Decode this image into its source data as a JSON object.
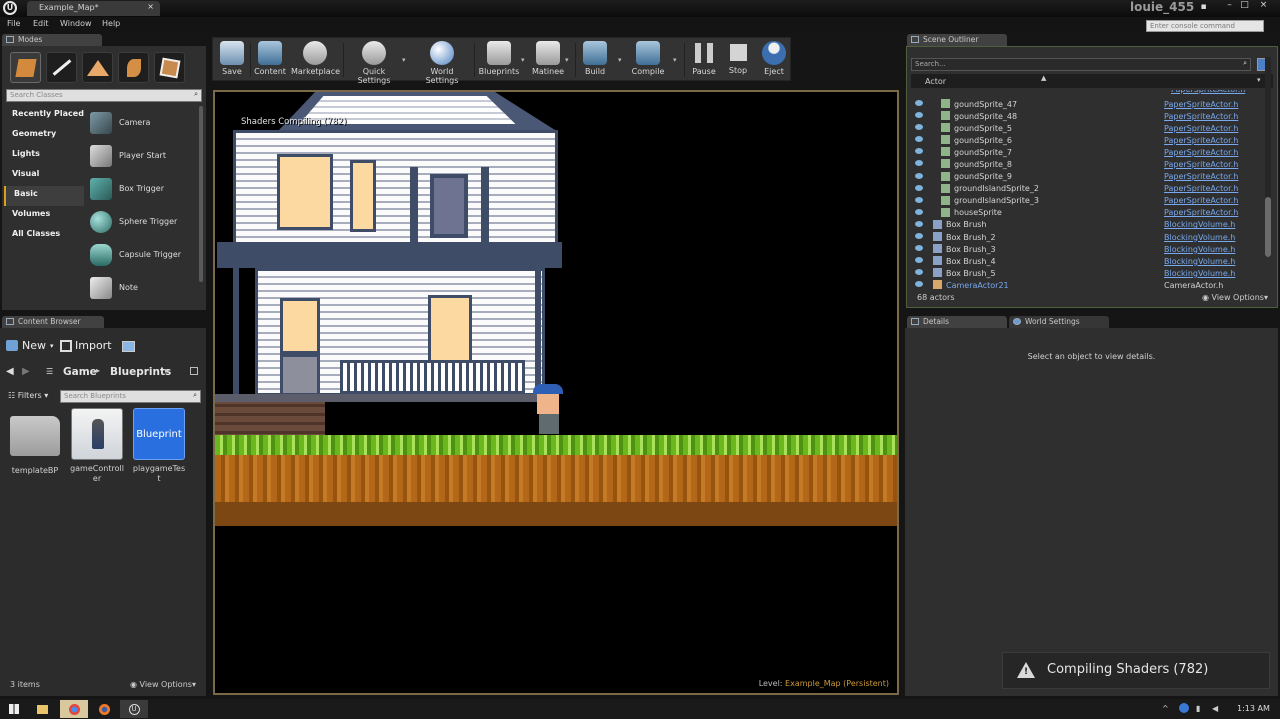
{
  "window": {
    "doc_tab": "Example_Map*",
    "username": "louie_455",
    "console_placeholder": "Enter console command"
  },
  "menu": [
    "File",
    "Edit",
    "Window",
    "Help"
  ],
  "modes": {
    "tab": "Modes",
    "search_placeholder": "Search Classes",
    "categories": [
      "Recently Placed",
      "Geometry",
      "Lights",
      "Visual",
      "Basic",
      "Volumes",
      "All Classes"
    ],
    "selected_category": "Basic",
    "items": [
      "Camera",
      "Player Start",
      "Box Trigger",
      "Sphere Trigger",
      "Capsule Trigger",
      "Note"
    ]
  },
  "toolbar": {
    "buttons": [
      "Save",
      "Content",
      "Marketplace",
      "Quick Settings",
      "World Settings",
      "Blueprints",
      "Matinee",
      "Build",
      "Compile",
      "Pause",
      "Stop",
      "Eject"
    ]
  },
  "viewport": {
    "overlay": "Shaders Compiling (782)",
    "level_label": "Level:",
    "level_name": "Example_Map (Persistent)"
  },
  "content_browser": {
    "tab": "Content Browser",
    "new_label": "New",
    "import_label": "Import",
    "path": [
      "Game",
      "Blueprints"
    ],
    "filters_label": "Filters",
    "search_placeholder": "Search Blueprints",
    "assets": [
      {
        "name": "templateBP",
        "kind": "folder"
      },
      {
        "name": "gameController",
        "kind": "blueprint"
      },
      {
        "name": "playgameTest",
        "kind": "blueprint"
      }
    ],
    "blueprint_thumb_label": "Blueprint",
    "item_count": "3 items",
    "view_options": "View Options"
  },
  "outliner": {
    "tab": "Scene Outliner",
    "search_placeholder": "Search...",
    "column": "Actor",
    "rows": [
      {
        "name": "goundSprite_47",
        "type": "PaperSpriteActor.h",
        "indent": 2,
        "selected": false
      },
      {
        "name": "goundSprite_48",
        "type": "PaperSpriteActor.h",
        "indent": 2,
        "selected": false
      },
      {
        "name": "goundSprite_5",
        "type": "PaperSpriteActor.h",
        "indent": 2,
        "selected": false
      },
      {
        "name": "goundSprite_6",
        "type": "PaperSpriteActor.h",
        "indent": 2,
        "selected": false
      },
      {
        "name": "goundSprite_7",
        "type": "PaperSpriteActor.h",
        "indent": 2,
        "selected": false
      },
      {
        "name": "goundSprite_8",
        "type": "PaperSpriteActor.h",
        "indent": 2,
        "selected": false
      },
      {
        "name": "goundSprite_9",
        "type": "PaperSpriteActor.h",
        "indent": 2,
        "selected": false
      },
      {
        "name": "groundIslandSprite_2",
        "type": "PaperSpriteActor.h",
        "indent": 2,
        "selected": false
      },
      {
        "name": "groundIslandSprite_3",
        "type": "PaperSpriteActor.h",
        "indent": 2,
        "selected": false
      },
      {
        "name": "houseSprite",
        "type": "PaperSpriteActor.h",
        "indent": 2,
        "selected": false
      },
      {
        "name": "Box Brush",
        "type": "BlockingVolume.h",
        "indent": 1,
        "selected": false
      },
      {
        "name": "Box Brush_2",
        "type": "BlockingVolume.h",
        "indent": 1,
        "selected": false
      },
      {
        "name": "Box Brush_3",
        "type": "BlockingVolume.h",
        "indent": 1,
        "selected": false
      },
      {
        "name": "Box Brush_4",
        "type": "BlockingVolume.h",
        "indent": 1,
        "selected": false
      },
      {
        "name": "Box Brush_5",
        "type": "BlockingVolume.h",
        "indent": 1,
        "selected": false
      },
      {
        "name": "CameraActor21",
        "type": "CameraActor.h",
        "indent": 1,
        "selected": true
      }
    ],
    "actor_count": "68 actors",
    "view_options": "View Options"
  },
  "details": {
    "tab_details": "Details",
    "tab_world": "World Settings",
    "empty_message": "Select an object to view details."
  },
  "toast": {
    "text": "Compiling Shaders (782)"
  },
  "taskbar": {
    "clock": "1:13 AM"
  }
}
